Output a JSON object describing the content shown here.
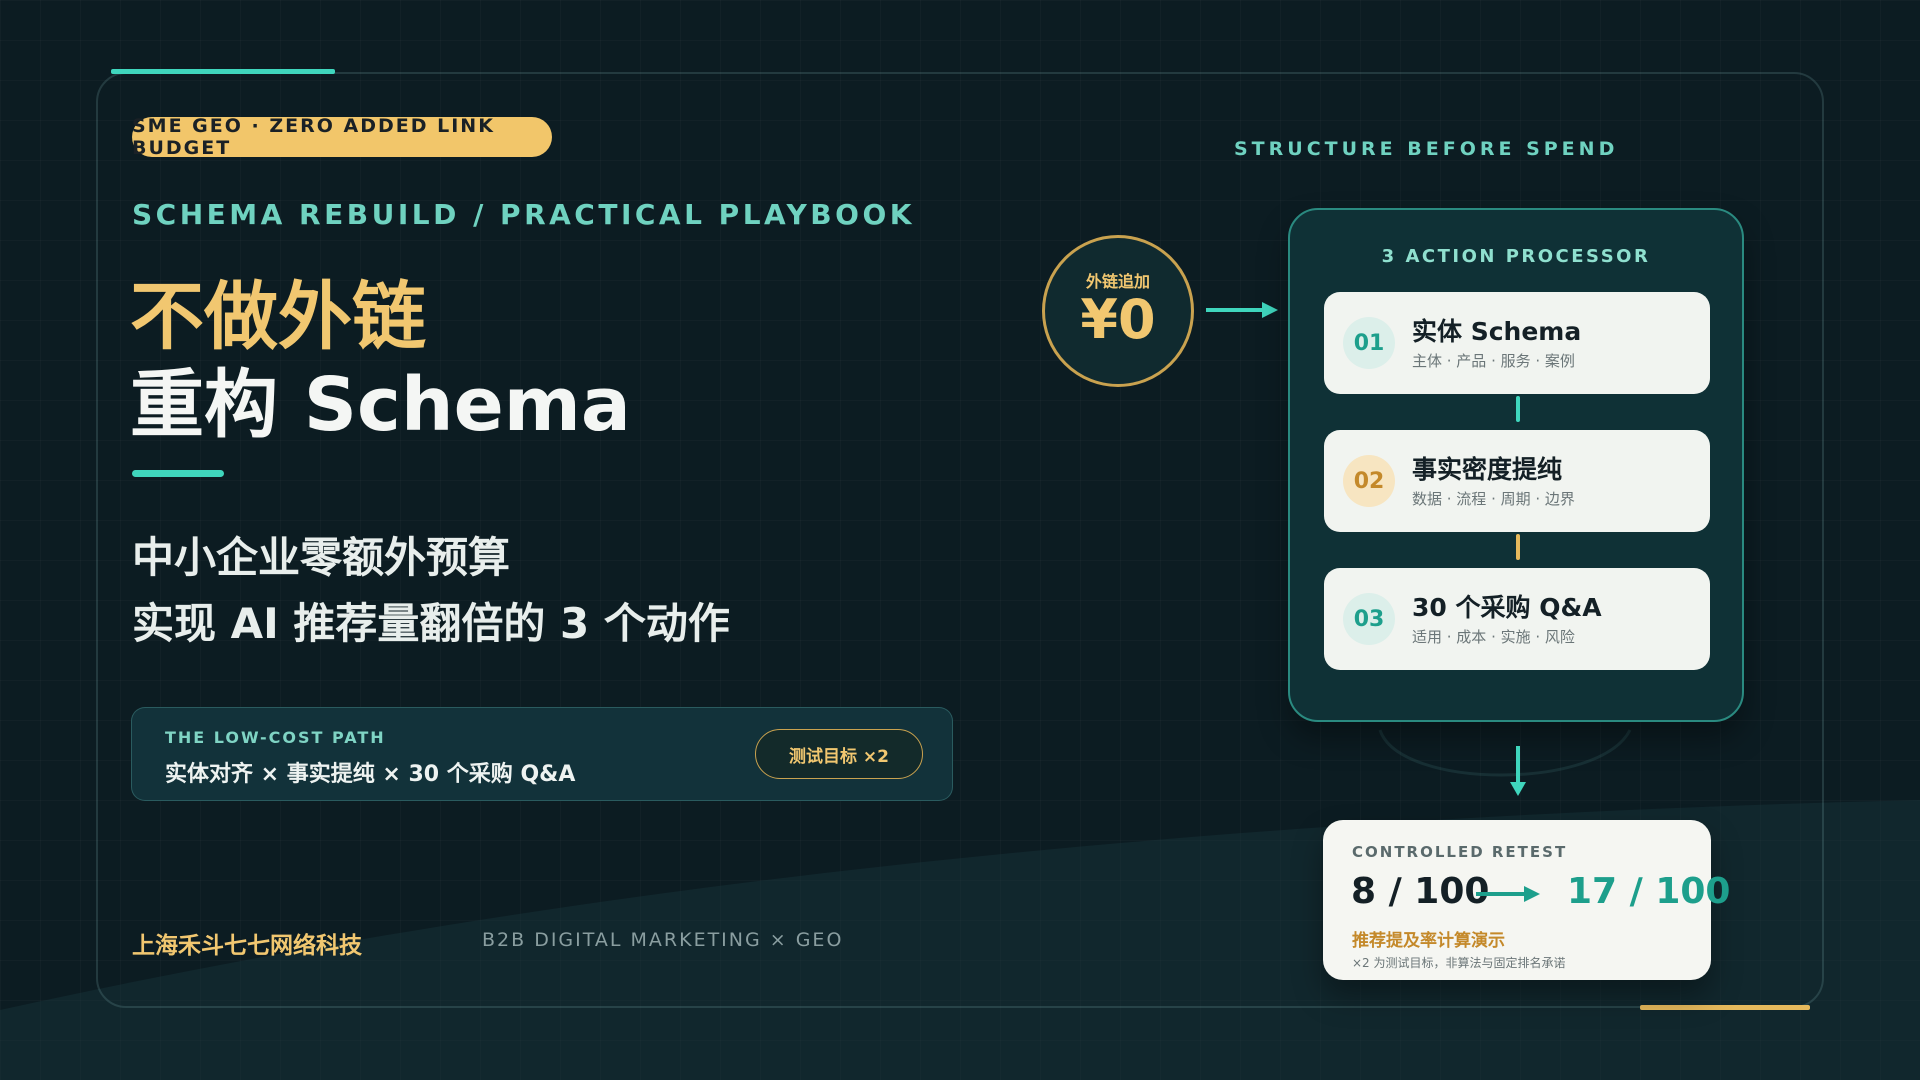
{
  "badge": "SME GEO · ZERO ADDED LINK BUDGET",
  "subtitle": "SCHEMA REBUILD / PRACTICAL PLAYBOOK",
  "title": {
    "line1": "不做外链",
    "line2": "重构 Schema"
  },
  "description": {
    "line1": "中小企业零额外预算",
    "line2": "实现 AI 推荐量翻倍的 3 个动作"
  },
  "path": {
    "label": "THE LOW-COST PATH",
    "text": "实体对齐 × 事实提纯 × 30 个采购 Q&A",
    "pill": "测试目标 ×2"
  },
  "footer": {
    "company": "上海禾斗七七网络科技",
    "tag": "B2B DIGITAL MARKETING × GEO"
  },
  "right": {
    "heading": "STRUCTURE BEFORE SPEND",
    "budget": {
      "label": "外链追加",
      "value": "¥0"
    },
    "processor": {
      "title": "3 ACTION PROCESSOR",
      "steps": [
        {
          "num": "01",
          "title": "实体 Schema",
          "sub": "主体 · 产品 · 服务 · 案例"
        },
        {
          "num": "02",
          "title": "事实密度提纯",
          "sub": "数据 · 流程 · 周期 · 边界"
        },
        {
          "num": "03",
          "title": "30 个采购 Q&A",
          "sub": "适用 · 成本 · 实施 · 风险"
        }
      ]
    },
    "retest": {
      "label": "CONTROLLED RETEST",
      "before": "8 / 100",
      "after": "17 / 100",
      "metric": "推荐提及率计算演示",
      "note": "×2 为测试目标，非算法与固定排名承诺"
    }
  },
  "colors": {
    "background": "#0c1c22",
    "teal": "#3fd6bd",
    "gold": "#f1c770"
  }
}
